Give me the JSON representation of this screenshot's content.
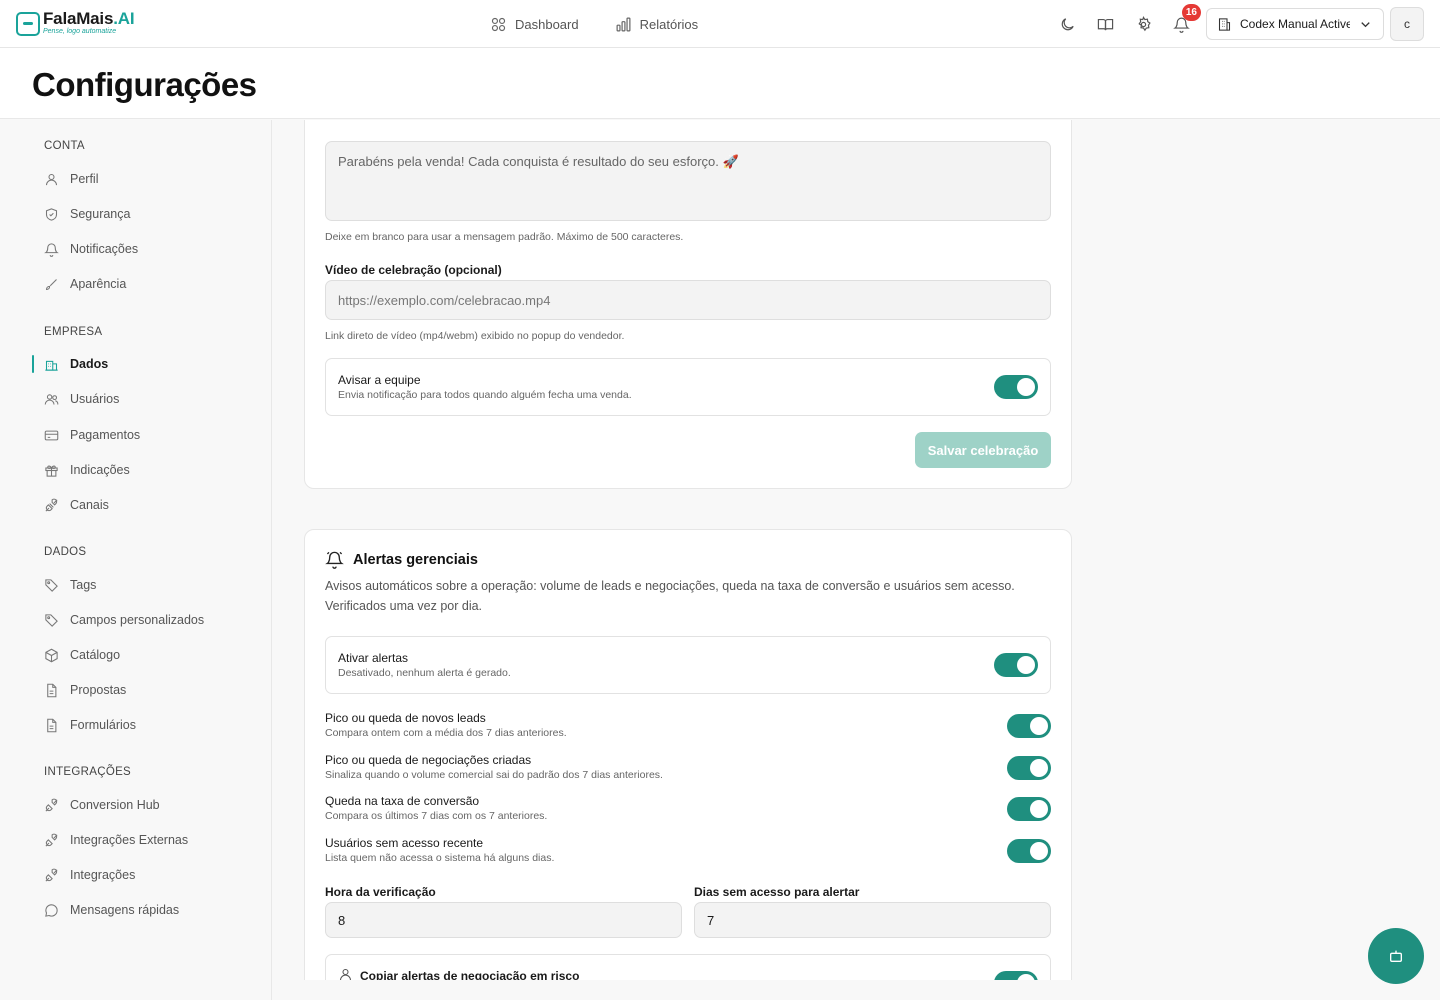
{
  "brand": {
    "name_main": "FalaMais",
    "name_accent": ".AI",
    "tagline": "Pense, logo automatize"
  },
  "topnav": {
    "dashboard": "Dashboard",
    "reports": "Relatórios"
  },
  "topbar": {
    "notification_count": "16",
    "company": "Codex Manual Active...",
    "avatar_initial": "c"
  },
  "page": {
    "title": "Configurações"
  },
  "sidebar": {
    "sections": {
      "conta": "CONTA",
      "empresa": "EMPRESA",
      "dados": "DADOS",
      "integracoes": "INTEGRAÇÕES"
    },
    "items": {
      "perfil": "Perfil",
      "seguranca": "Segurança",
      "notificacoes": "Notificações",
      "aparencia": "Aparência",
      "dados": "Dados",
      "usuarios": "Usuários",
      "pagamentos": "Pagamentos",
      "indicacoes": "Indicações",
      "canais": "Canais",
      "tags": "Tags",
      "campos": "Campos personalizados",
      "catalogo": "Catálogo",
      "propostas": "Propostas",
      "formularios": "Formulários",
      "conversion_hub": "Conversion Hub",
      "integracoes_externas": "Integrações Externas",
      "integracoes": "Integrações",
      "mensagens_rapidas": "Mensagens rápidas"
    }
  },
  "celebration": {
    "message_value": "Parabéns pela venda! Cada conquista é resultado do seu esforço. 🚀",
    "message_hint": "Deixe em branco para usar a mensagem padrão. Máximo de 500 caracteres.",
    "video_label": "Vídeo de celebração (opcional)",
    "video_placeholder": "https://exemplo.com/celebracao.mp4",
    "video_hint": "Link direto de vídeo (mp4/webm) exibido no popup do vendedor.",
    "notify_title": "Avisar a equipe",
    "notify_desc": "Envia notificação para todos quando alguém fecha uma venda.",
    "notify_enabled": true,
    "save_label": "Salvar celebração"
  },
  "alerts": {
    "title": "Alertas gerenciais",
    "description": "Avisos automáticos sobre a operação: volume de leads e negociações, queda na taxa de conversão e usuários sem acesso. Verificados uma vez por dia.",
    "enable_title": "Ativar alertas",
    "enable_desc": "Desativado, nenhum alerta é gerado.",
    "rows": [
      {
        "title": "Pico ou queda de novos leads",
        "desc": "Compara ontem com a média dos 7 dias anteriores.",
        "enabled": true
      },
      {
        "title": "Pico ou queda de negociações criadas",
        "desc": "Sinaliza quando o volume comercial sai do padrão dos 7 dias anteriores.",
        "enabled": true
      },
      {
        "title": "Queda na taxa de conversão",
        "desc": "Compara os últimos 7 dias com os 7 anteriores.",
        "enabled": true
      },
      {
        "title": "Usuários sem acesso recente",
        "desc": "Lista quem não acessa o sistema há alguns dias.",
        "enabled": true
      }
    ],
    "hour_label": "Hora da verificação",
    "hour_value": "8",
    "days_label": "Dias sem acesso para alertar",
    "days_value": "7",
    "copy_title": "Copiar alertas de negociação em risco"
  },
  "colors": {
    "accent": "#1aa39a",
    "toggle_on": "#1f8f7f",
    "button_disabled": "#9ed2c7",
    "badge": "#e53935"
  }
}
